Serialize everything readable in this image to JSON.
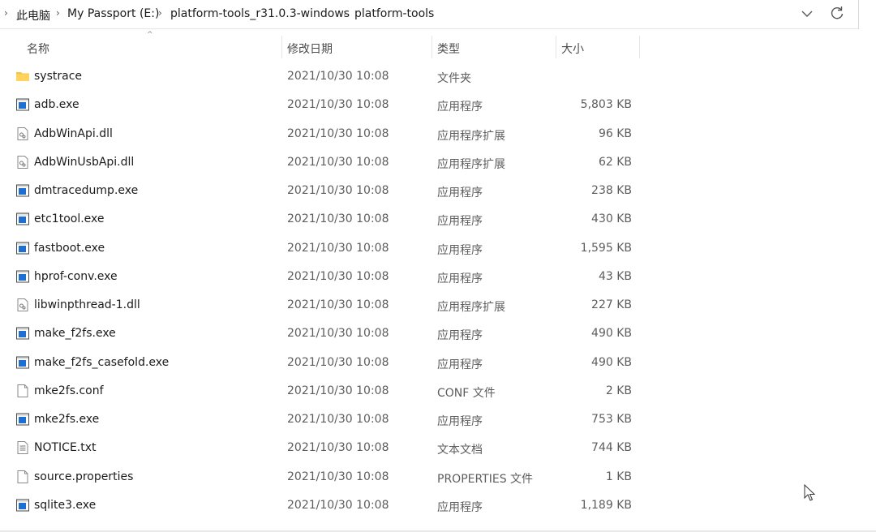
{
  "breadcrumb": [
    "此电脑",
    "My Passport (E:)",
    "platform-tools_r31.0.3-windows",
    "platform-tools"
  ],
  "columns": {
    "name": "名称",
    "date": "修改日期",
    "type": "类型",
    "size": "大小"
  },
  "files": [
    {
      "name": "systrace",
      "date": "2021/10/30 10:08",
      "type": "文件夹",
      "size": "",
      "icon": "folder-icon"
    },
    {
      "name": "adb.exe",
      "date": "2021/10/30 10:08",
      "type": "应用程序",
      "size": "5,803 KB",
      "icon": "exe-icon"
    },
    {
      "name": "AdbWinApi.dll",
      "date": "2021/10/30 10:08",
      "type": "应用程序扩展",
      "size": "96 KB",
      "icon": "dll-icon"
    },
    {
      "name": "AdbWinUsbApi.dll",
      "date": "2021/10/30 10:08",
      "type": "应用程序扩展",
      "size": "62 KB",
      "icon": "dll-icon"
    },
    {
      "name": "dmtracedump.exe",
      "date": "2021/10/30 10:08",
      "type": "应用程序",
      "size": "238 KB",
      "icon": "exe-icon"
    },
    {
      "name": "etc1tool.exe",
      "date": "2021/10/30 10:08",
      "type": "应用程序",
      "size": "430 KB",
      "icon": "exe-icon"
    },
    {
      "name": "fastboot.exe",
      "date": "2021/10/30 10:08",
      "type": "应用程序",
      "size": "1,595 KB",
      "icon": "exe-icon"
    },
    {
      "name": "hprof-conv.exe",
      "date": "2021/10/30 10:08",
      "type": "应用程序",
      "size": "43 KB",
      "icon": "exe-icon"
    },
    {
      "name": "libwinpthread-1.dll",
      "date": "2021/10/30 10:08",
      "type": "应用程序扩展",
      "size": "227 KB",
      "icon": "dll-icon"
    },
    {
      "name": "make_f2fs.exe",
      "date": "2021/10/30 10:08",
      "type": "应用程序",
      "size": "490 KB",
      "icon": "exe-icon"
    },
    {
      "name": "make_f2fs_casefold.exe",
      "date": "2021/10/30 10:08",
      "type": "应用程序",
      "size": "490 KB",
      "icon": "exe-icon"
    },
    {
      "name": "mke2fs.conf",
      "date": "2021/10/30 10:08",
      "type": "CONF 文件",
      "size": "2 KB",
      "icon": "file-icon"
    },
    {
      "name": "mke2fs.exe",
      "date": "2021/10/30 10:08",
      "type": "应用程序",
      "size": "753 KB",
      "icon": "exe-icon"
    },
    {
      "name": "NOTICE.txt",
      "date": "2021/10/30 10:08",
      "type": "文本文档",
      "size": "744 KB",
      "icon": "text-file-icon"
    },
    {
      "name": "source.properties",
      "date": "2021/10/30 10:08",
      "type": "PROPERTIES 文件",
      "size": "1 KB",
      "icon": "file-icon"
    },
    {
      "name": "sqlite3.exe",
      "date": "2021/10/30 10:08",
      "type": "应用程序",
      "size": "1,189 KB",
      "icon": "exe-icon"
    }
  ],
  "colors": {
    "folder": "#f6c342",
    "exe_blue": "#1f6fd1",
    "header_text": "#4c4c4c"
  }
}
